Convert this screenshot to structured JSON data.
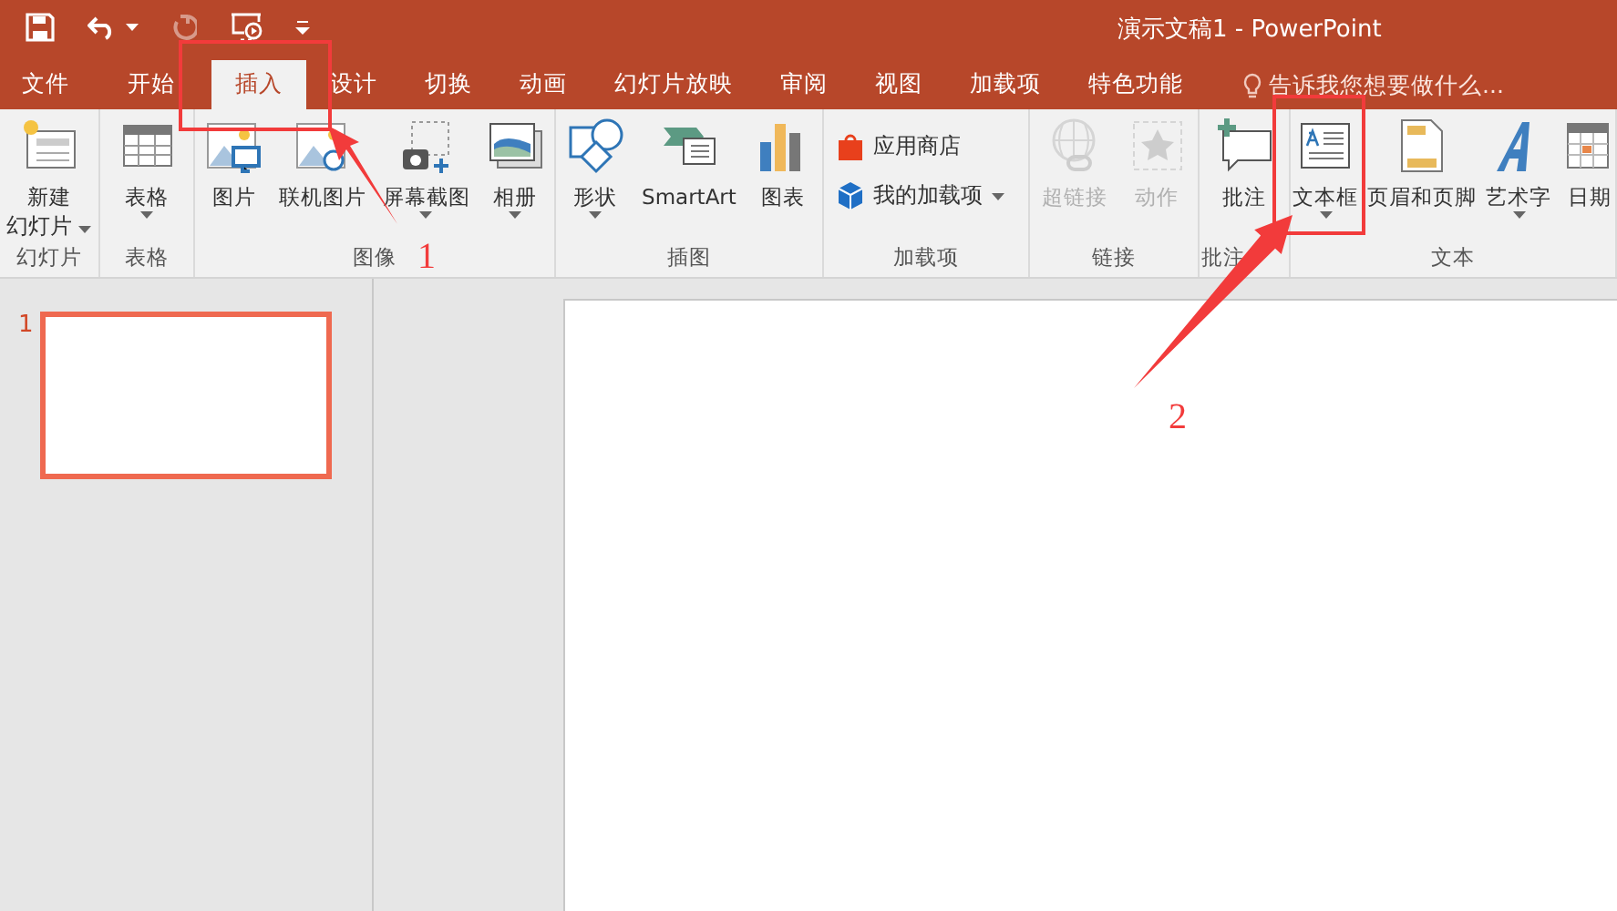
{
  "window": {
    "title": "演示文稿1 - PowerPoint"
  },
  "quick_access": [
    {
      "kind": "save",
      "disabled": false
    },
    {
      "kind": "undo",
      "disabled": false
    },
    {
      "kind": "redo",
      "disabled": true
    },
    {
      "kind": "present",
      "disabled": false
    },
    {
      "kind": "customize",
      "disabled": false
    }
  ],
  "tabs": [
    {
      "label": "文件",
      "selected": false
    },
    {
      "label": "开始",
      "selected": false
    },
    {
      "label": "插入",
      "selected": true
    },
    {
      "label": "设计",
      "selected": false
    },
    {
      "label": "切换",
      "selected": false
    },
    {
      "label": "动画",
      "selected": false
    },
    {
      "label": "幻灯片放映",
      "selected": false
    },
    {
      "label": "审阅",
      "selected": false
    },
    {
      "label": "视图",
      "selected": false
    },
    {
      "label": "加载项",
      "selected": false
    },
    {
      "label": "特色功能",
      "selected": false
    }
  ],
  "tell_me": {
    "placeholder": "告诉我您想要做什么..."
  },
  "ribbon_groups": [
    {
      "label": "幻灯片",
      "kind": "large",
      "buttons": [
        {
          "label": "新建",
          "label2": "幻灯片",
          "dropdown": true,
          "disabled": false
        }
      ]
    },
    {
      "label": "表格",
      "kind": "large",
      "buttons": [
        {
          "label": "表格",
          "dropdown": true,
          "disabled": false
        }
      ]
    },
    {
      "label": "图像",
      "kind": "large",
      "buttons": [
        {
          "label": "图片",
          "dropdown": false,
          "disabled": false
        },
        {
          "label": "联机图片",
          "dropdown": false,
          "disabled": false
        },
        {
          "label": "屏幕截图",
          "dropdown": true,
          "disabled": false
        },
        {
          "label": "相册",
          "dropdown": true,
          "disabled": false
        }
      ]
    },
    {
      "label": "插图",
      "kind": "large",
      "buttons": [
        {
          "label": "形状",
          "dropdown": true,
          "disabled": false
        },
        {
          "label": "SmartArt",
          "dropdown": false,
          "disabled": false
        },
        {
          "label": "图表",
          "dropdown": false,
          "disabled": false
        }
      ]
    },
    {
      "label": "加载项",
      "kind": "small",
      "buttons": [
        {
          "label": "应用商店",
          "dropdown": false,
          "disabled": false
        },
        {
          "label": "我的加载项",
          "dropdown": true,
          "disabled": false
        }
      ]
    },
    {
      "label": "链接",
      "kind": "large",
      "buttons": [
        {
          "label": "超链接",
          "dropdown": false,
          "disabled": true
        },
        {
          "label": "动作",
          "dropdown": false,
          "disabled": true
        }
      ]
    },
    {
      "label": "批注",
      "kind": "large",
      "buttons": [
        {
          "label": "批注",
          "dropdown": false,
          "disabled": false
        }
      ]
    },
    {
      "label": "文本",
      "kind": "large",
      "buttons": [
        {
          "label": "文本框",
          "dropdown": true,
          "disabled": false
        },
        {
          "label": "页眉和页脚",
          "dropdown": false,
          "disabled": false
        },
        {
          "label": "艺术字",
          "dropdown": true,
          "disabled": false
        },
        {
          "label": "日期",
          "dropdown": false,
          "disabled": false
        }
      ]
    }
  ],
  "slides": [
    {
      "number": "1",
      "selected": true
    }
  ],
  "annotations": [
    {
      "label": "1"
    },
    {
      "label": "2"
    }
  ]
}
